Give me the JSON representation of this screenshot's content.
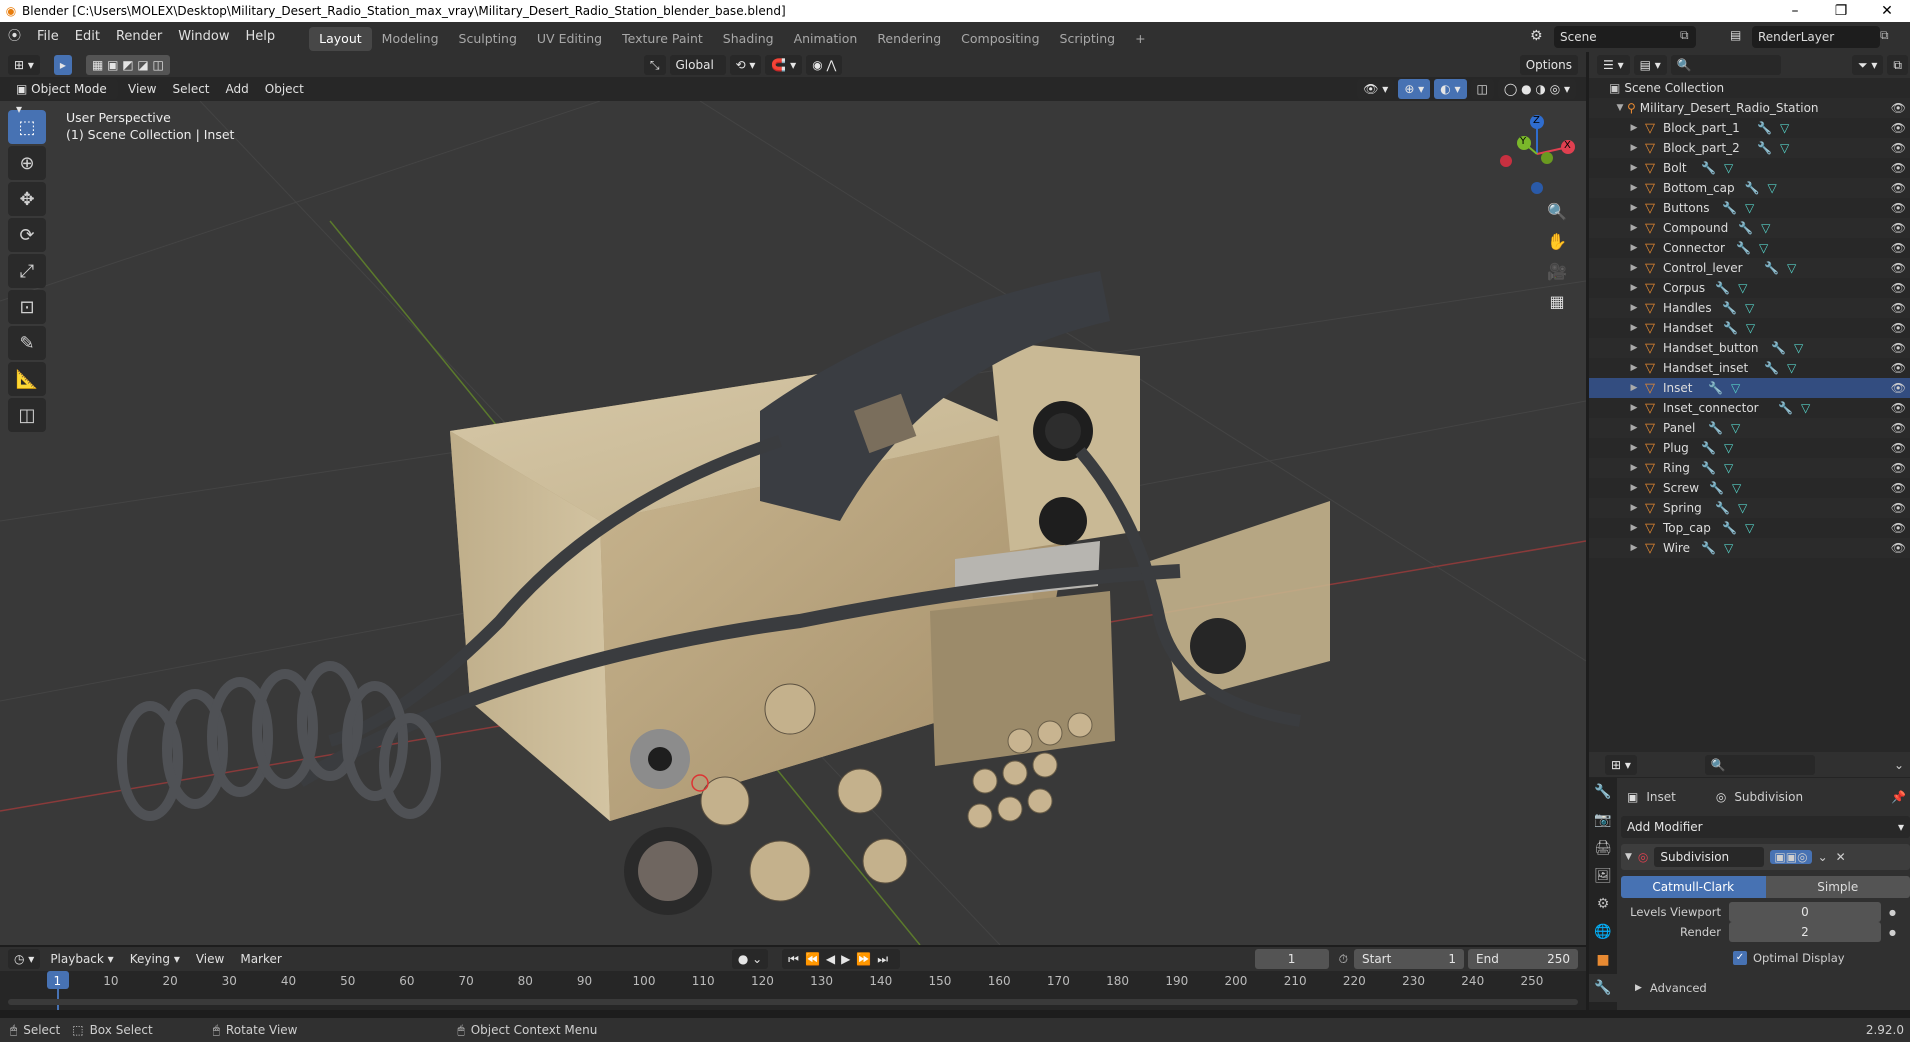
{
  "window": {
    "title": "Blender [C:\\Users\\MOLEX\\Desktop\\Military_Desert_Radio_Station_max_vray\\Military_Desert_Radio_Station_blender_base.blend]"
  },
  "menu": [
    "File",
    "Edit",
    "Render",
    "Window",
    "Help"
  ],
  "workspaces": [
    "Layout",
    "Modeling",
    "Sculpting",
    "UV Editing",
    "Texture Paint",
    "Shading",
    "Animation",
    "Rendering",
    "Compositing",
    "Scripting"
  ],
  "scene": {
    "name": "Scene",
    "layer": "RenderLayer"
  },
  "header3d": {
    "orientation": "Global",
    "options": "Options"
  },
  "subheader": {
    "mode": "Object Mode",
    "menus": [
      "View",
      "Select",
      "Add",
      "Object"
    ]
  },
  "viewport": {
    "perspective": "User Perspective",
    "collection": "(1) Scene Collection | Inset"
  },
  "gizmo": {
    "x": "X",
    "y": "Y",
    "z": "Z"
  },
  "outliner": {
    "root": "Scene Collection",
    "collection": "Military_Desert_Radio_Station",
    "objects": [
      "Block_part_1",
      "Block_part_2",
      "Bolt",
      "Bottom_cap",
      "Buttons",
      "Compound",
      "Connector",
      "Control_lever",
      "Corpus",
      "Handles",
      "Handset",
      "Handset_button",
      "Handset_inset",
      "Inset",
      "Inset_connector",
      "Panel",
      "Plug",
      "Ring",
      "Screw",
      "Spring",
      "Top_cap",
      "Wire"
    ],
    "selected": "Inset"
  },
  "properties": {
    "object": "Inset",
    "modifier_name": "Subdivision",
    "add_modifier": "Add Modifier",
    "catmull": "Catmull-Clark",
    "simple": "Simple",
    "levels_label": "Levels Viewport",
    "levels_value": "0",
    "render_label": "Render",
    "render_value": "2",
    "optimal": "Optimal Display",
    "advanced": "Advanced"
  },
  "timeline": {
    "menus": [
      "Playback",
      "Keying",
      "View",
      "Marker"
    ],
    "current": "1",
    "start_label": "Start",
    "start": "1",
    "end_label": "End",
    "end": "250",
    "ticks": [
      "1",
      "10",
      "20",
      "30",
      "40",
      "50",
      "60",
      "70",
      "80",
      "90",
      "100",
      "110",
      "120",
      "130",
      "140",
      "150",
      "160",
      "170",
      "180",
      "190",
      "200",
      "210",
      "220",
      "230",
      "240",
      "250"
    ]
  },
  "status": {
    "select": "Select",
    "box_select": "Box Select",
    "rotate": "Rotate View",
    "context": "Object Context Menu",
    "version": "2.92.0"
  }
}
